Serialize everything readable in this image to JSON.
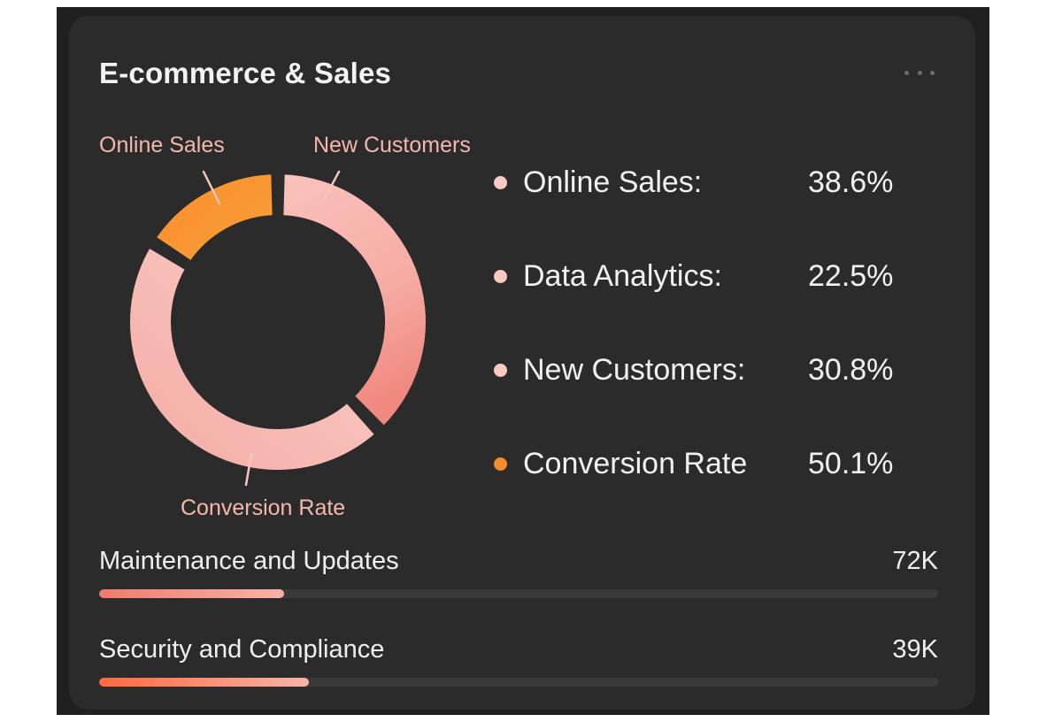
{
  "card": {
    "title": "E-commerce & Sales",
    "menu_icon": "more-horizontal-icon"
  },
  "chart_data": {
    "type": "pie",
    "variant": "donut",
    "labels": [
      "Online Sales",
      "New Customers",
      "Conversion Rate"
    ],
    "slices": [
      {
        "name": "Online Sales",
        "value": 16,
        "color": "#f7952f"
      },
      {
        "name": "New Customers",
        "value": 38,
        "color": "#f7b1a8"
      },
      {
        "name": "Conversion Rate",
        "value": 46,
        "color": "#f8c2bc"
      }
    ]
  },
  "legend": [
    {
      "label": "Online Sales:",
      "value": "38.6%",
      "color": "#f9c9c2"
    },
    {
      "label": "Data Analytics:",
      "value": "22.5%",
      "color": "#f9c9c2"
    },
    {
      "label": "New Customers:",
      "value": "30.8%",
      "color": "#f9c9c2"
    },
    {
      "label": "Conversion Rate",
      "value": "50.1%",
      "color": "#f48a2f"
    }
  ],
  "metrics": [
    {
      "label": "Maintenance and Updates",
      "value": "72K",
      "progress": 0.22
    },
    {
      "label": "Security and Compliance",
      "value": "39K",
      "progress": 0.25
    }
  ],
  "colors": {
    "accent_orange": "#f7952f",
    "accent_pink": "#f7b1a8",
    "card_bg": "#2b2b2b",
    "page_bg": "#202020"
  }
}
